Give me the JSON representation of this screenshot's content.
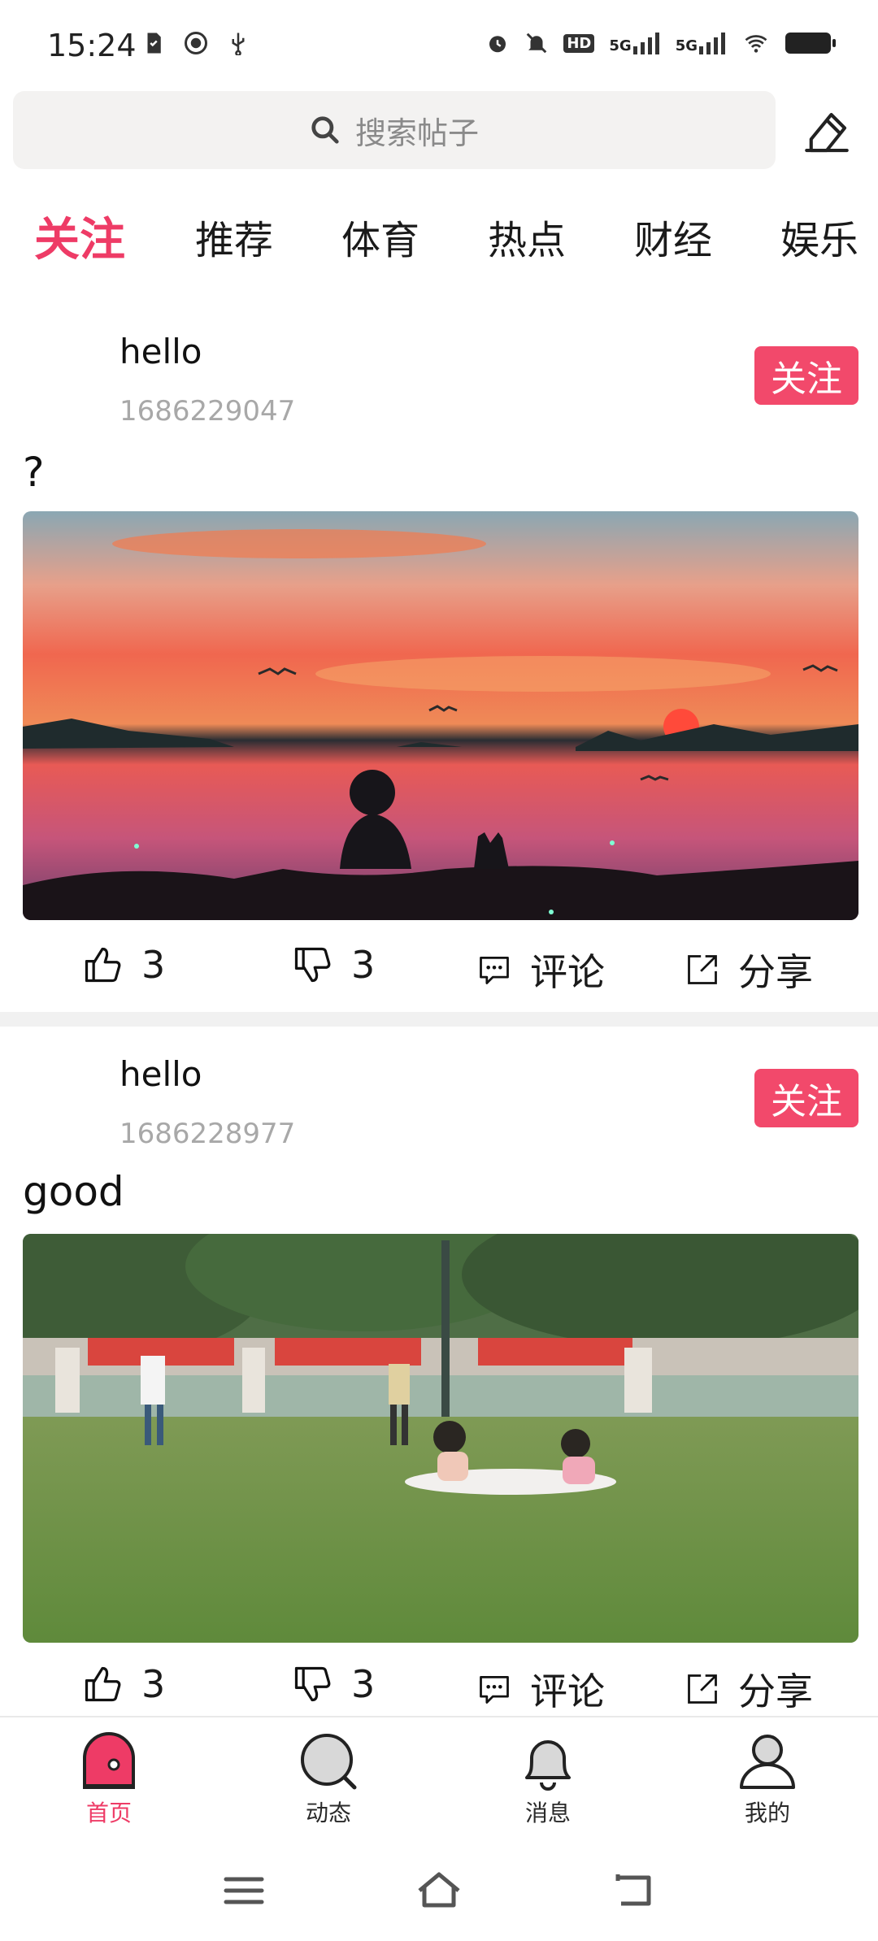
{
  "status_bar": {
    "time": "15:24",
    "left_icons": [
      "sim-card-icon",
      "screen-record-icon",
      "usb-icon"
    ],
    "right_icons": [
      "alarm-icon",
      "mute-icon",
      "hd-icon",
      "signal-5g-icon",
      "signal-5g-icon",
      "wifi-icon",
      "battery-icon"
    ],
    "hd_label": "HD",
    "net_label_1": "5G",
    "net_label_2": "5G"
  },
  "search": {
    "placeholder": "搜索帖子"
  },
  "tabs": [
    {
      "label": "关注",
      "active": true
    },
    {
      "label": "推荐",
      "active": false
    },
    {
      "label": "体育",
      "active": false
    },
    {
      "label": "热点",
      "active": false
    },
    {
      "label": "财经",
      "active": false
    },
    {
      "label": "娱乐",
      "active": false
    }
  ],
  "posts": [
    {
      "author": "hello",
      "user_id": "1686229047",
      "follow_label": "关注",
      "text": "?",
      "image": "sunset-lake-illustration",
      "likes": "3",
      "dislikes": "3",
      "comment_label": "评论",
      "share_label": "分享"
    },
    {
      "author": "hello",
      "user_id": "1686228977",
      "follow_label": "关注",
      "text": "good",
      "image": "park-lawn-photo",
      "likes": "3",
      "dislikes": "3",
      "comment_label": "评论",
      "share_label": "分享"
    }
  ],
  "bottom_nav": [
    {
      "label": "首页",
      "icon": "home-icon",
      "active": true
    },
    {
      "label": "动态",
      "icon": "search-icon",
      "active": false
    },
    {
      "label": "消息",
      "icon": "bell-icon",
      "active": false
    },
    {
      "label": "我的",
      "icon": "user-icon",
      "active": false
    }
  ],
  "colors": {
    "accent": "#ee3b66",
    "follow_button": "#f2496b",
    "muted_text": "#a8a8a8",
    "search_bg": "#f3f2f1"
  }
}
